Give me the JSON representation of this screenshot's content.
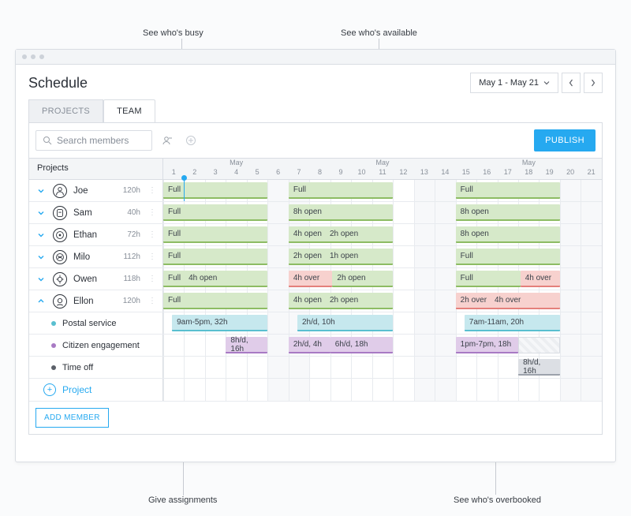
{
  "annotations": {
    "busy": "See who's busy",
    "available": "See who's available",
    "assignments": "Give assignments",
    "overbooked": "See who's overbooked"
  },
  "page_title": "Schedule",
  "date_range": "May 1 - May 21",
  "tabs": {
    "projects": "PROJECTS",
    "team": "TEAM"
  },
  "search": {
    "placeholder": "Search members"
  },
  "publish_label": "PUBLISH",
  "grid": {
    "column_header": "Projects",
    "month_label": "May",
    "days_start": 1,
    "days_end": 21
  },
  "members": [
    {
      "name": "Joe",
      "hours": "120h"
    },
    {
      "name": "Sam",
      "hours": "40h"
    },
    {
      "name": "Ethan",
      "hours": "72h"
    },
    {
      "name": "Milo",
      "hours": "112h"
    },
    {
      "name": "Owen",
      "hours": "118h"
    },
    {
      "name": "Ellon",
      "hours": "120h"
    }
  ],
  "projects": [
    {
      "name": "Postal service",
      "color": "#59bfd0"
    },
    {
      "name": "Citizen engagement",
      "color": "#a87ac4"
    },
    {
      "name": "Time off",
      "color": "#5b6069"
    }
  ],
  "add_project_label": "Project",
  "add_member_label": "ADD MEMBER",
  "blocks": {
    "joe": [
      {
        "w": 0,
        "text": [
          "Full"
        ],
        "cls": "green"
      },
      {
        "w": 1,
        "text": [
          "Full"
        ],
        "cls": "green"
      },
      {
        "w": 2,
        "text": [
          "Full"
        ],
        "cls": "green"
      }
    ],
    "sam": [
      {
        "w": 0,
        "text": [
          "Full"
        ],
        "cls": "green"
      },
      {
        "w": 1,
        "text": [
          "8h open"
        ],
        "cls": "green"
      },
      {
        "w": 2,
        "text": [
          "8h open"
        ],
        "cls": "green"
      }
    ],
    "ethan": [
      {
        "w": 0,
        "text": [
          "Full"
        ],
        "cls": "green"
      },
      {
        "w": 1,
        "text": [
          "4h open",
          "2h open"
        ],
        "cls": "green"
      },
      {
        "w": 2,
        "text": [
          "8h open"
        ],
        "cls": "green"
      }
    ],
    "milo": [
      {
        "w": 0,
        "text": [
          "Full"
        ],
        "cls": "green"
      },
      {
        "w": 1,
        "text": [
          "2h open",
          "1h open"
        ],
        "cls": "green"
      },
      {
        "w": 2,
        "text": [
          "Full"
        ],
        "cls": "green"
      }
    ],
    "owen": [
      {
        "w": 0,
        "text": [
          "Full",
          "4h open"
        ],
        "cls": "green"
      },
      {
        "w": 1,
        "text": [
          "4h over",
          "2h open"
        ],
        "cls": "red-green"
      },
      {
        "w": 2,
        "text": [
          "Full",
          "4h over"
        ],
        "cls": "green-red"
      }
    ],
    "ellon": [
      {
        "w": 0,
        "text": [
          "Full"
        ],
        "cls": "green"
      },
      {
        "w": 1,
        "text": [
          "4h open",
          "2h open"
        ],
        "cls": "green"
      },
      {
        "w": 2,
        "text": [
          "2h over",
          "4h over"
        ],
        "cls": "red"
      }
    ],
    "postal": [
      {
        "w": 0,
        "text": "9am-5pm, 32h"
      },
      {
        "w": 1,
        "text": "2h/d, 10h"
      },
      {
        "w": 2,
        "text": "7am-11am, 20h"
      }
    ],
    "citizen": [
      {
        "w": 0,
        "text": "8h/d, 16h",
        "half": true
      },
      {
        "w": 1,
        "text": [
          "2h/d, 4h",
          "6h/d, 18h"
        ]
      },
      {
        "w": 2,
        "text": "1pm-7pm, 18h",
        "trail_hatch": true
      }
    ],
    "timeoff": [
      {
        "w": 2,
        "text": "8h/d, 16h",
        "tail": true
      }
    ]
  }
}
